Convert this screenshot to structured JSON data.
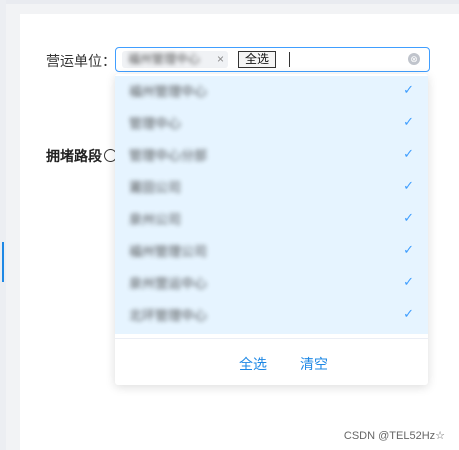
{
  "form": {
    "label": "营运单位",
    "colon": "：",
    "selected_tag": "福州管理中心",
    "tag_close": "×",
    "inline_select_all": "全选",
    "clear_icon": "⊗"
  },
  "section": {
    "title": "拥堵路段"
  },
  "dropdown": {
    "options": [
      {
        "label": "福州管理中心"
      },
      {
        "label": "管理中心"
      },
      {
        "label": "管理中心分部"
      },
      {
        "label": "莆田公司"
      },
      {
        "label": "泉州公司"
      },
      {
        "label": "福州管理公司"
      },
      {
        "label": "泉州营运中心"
      },
      {
        "label": "北环管理中心"
      }
    ],
    "check_icon": "✓",
    "select_all": "全选",
    "clear": "清空"
  },
  "watermark": "CSDN @TEL52Hz☆",
  "colors": {
    "primary": "#409eff",
    "option_bg": "#e6f4ff",
    "footer_link": "#1e88e5"
  }
}
